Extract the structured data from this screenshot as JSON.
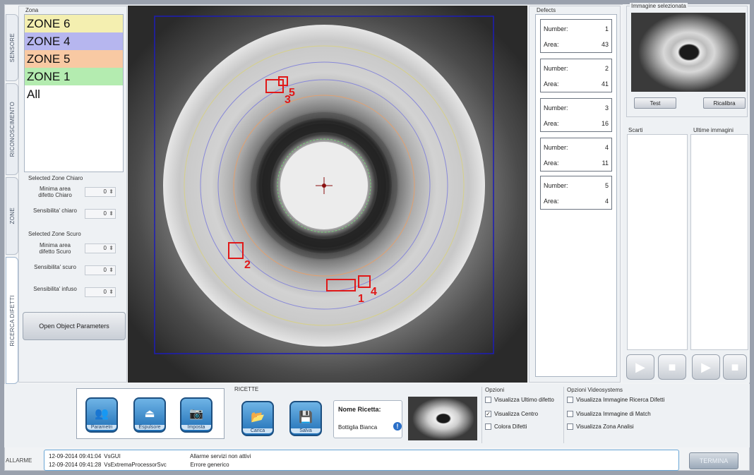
{
  "tabs": [
    {
      "label": "SENSORE"
    },
    {
      "label": "RICONOSCIMENTO"
    },
    {
      "label": "ZONE"
    },
    {
      "label": "RICERCA DIFETTI"
    }
  ],
  "left": {
    "zone_title": "Zona",
    "zones": [
      {
        "label": "ZONE 6",
        "color": "#f4efb0"
      },
      {
        "label": "ZONE 4",
        "color": "#b6b6ef"
      },
      {
        "label": "ZONE 5",
        "color": "#f8c9a3"
      },
      {
        "label": "ZONE 1",
        "color": "#b4ecb0"
      },
      {
        "label": "All",
        "color": "#ffffff"
      }
    ],
    "chiaro": {
      "title": "Selected Zone Chiaro",
      "fields": [
        {
          "label": "Minima area difetto Chiaro",
          "value": "0"
        },
        {
          "label": "Sensibilita' chiaro",
          "value": "0"
        }
      ]
    },
    "scuro": {
      "title": "Selected Zone Scuro",
      "fields": [
        {
          "label": "Minima area difetto Scuro",
          "value": "0"
        },
        {
          "label": "Sensibilita' scuro",
          "value": "0"
        },
        {
          "label": "Sensibilita' infuso",
          "value": "0"
        }
      ]
    },
    "open_button": "Open Object Parameters"
  },
  "viewer": {
    "marks": [
      "1",
      "2",
      "3",
      "4",
      "5"
    ]
  },
  "defects": {
    "title": "Defects",
    "number_label": "Number:",
    "area_label": "Area:",
    "items": [
      {
        "number": "1",
        "area": "43"
      },
      {
        "number": "2",
        "area": "41"
      },
      {
        "number": "3",
        "area": "16"
      },
      {
        "number": "4",
        "area": "11"
      },
      {
        "number": "5",
        "area": "4"
      }
    ]
  },
  "right": {
    "selected_title": "Immagine selezionata",
    "test_button": "Test",
    "reload_button": "Ricalibra",
    "scarti_label": "Scarti",
    "ultime_label": "Ultime immagini"
  },
  "actions": {
    "parametri": "Parametri",
    "espulsore": "Espulsore",
    "imposta": "Imposta"
  },
  "ricette": {
    "title": "RICETTE",
    "carica": "Carica",
    "salva": "Salva",
    "nome_label": "Nome Ricetta:",
    "nome_value": "Bottiglia Bianca"
  },
  "opzioni": {
    "title": "Opzioni",
    "items": [
      {
        "label": "Visualizza Ultimo difetto",
        "checked": false
      },
      {
        "label": "Visualizza Centro",
        "checked": true
      },
      {
        "label": "Colora Difetti",
        "checked": false
      }
    ]
  },
  "opzioni_video": {
    "title": "Opzioni Videosystems",
    "items": [
      {
        "label": "Visualizza Immagine Ricerca Difetti",
        "checked": false
      },
      {
        "label": "Visualizza Immagine di Match",
        "checked": false
      },
      {
        "label": "Visualizza Zona Analisi",
        "checked": false
      }
    ]
  },
  "log": {
    "label": "ALLARME",
    "rows": [
      {
        "time": "12-09-2014 09:41:04",
        "source": "VsGUI",
        "message": "Allarme servizi non attivi"
      },
      {
        "time": "12-09-2014 09:41:28",
        "source": "VsExtremaProcessorSvc",
        "message": "Errore generico"
      }
    ]
  },
  "termina": "TERMINA"
}
